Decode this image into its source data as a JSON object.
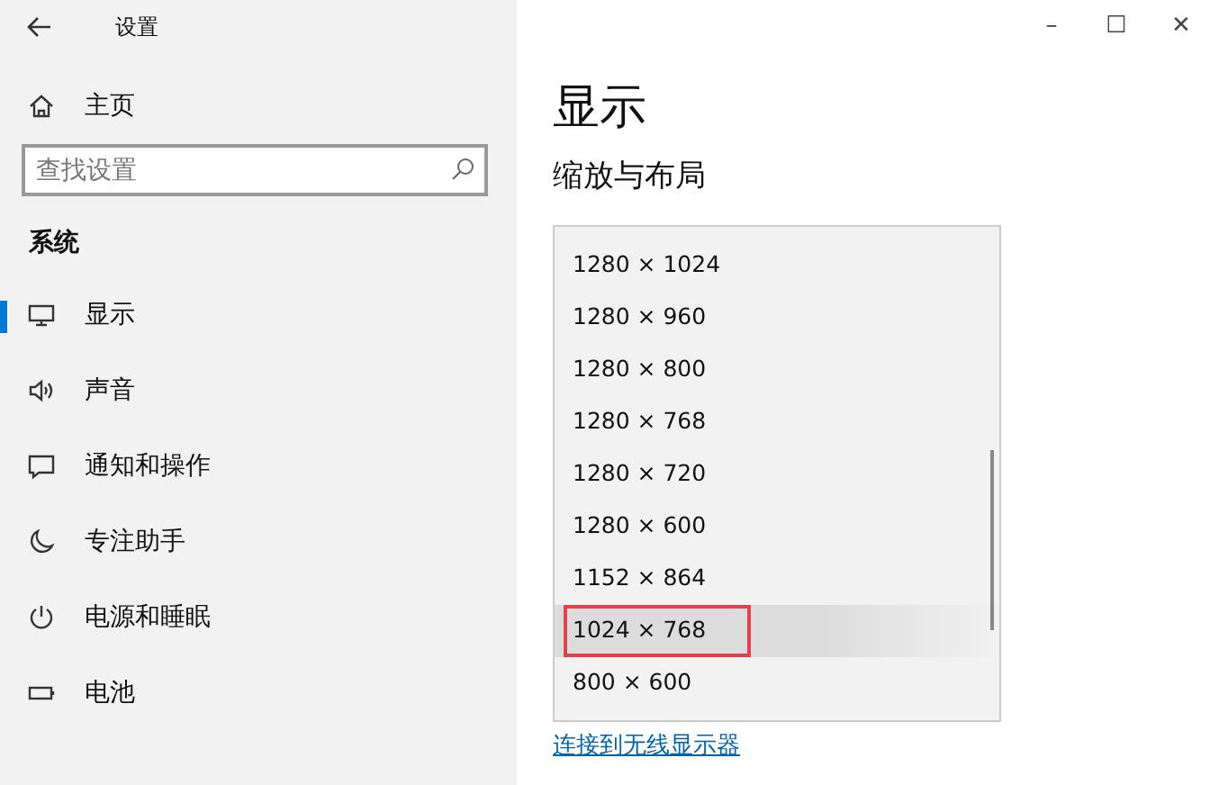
{
  "window": {
    "title": "设置",
    "controls": [
      "–",
      "☐",
      "✕"
    ]
  },
  "sidebar": {
    "home": "主页",
    "search": {
      "placeholder": "查找设置"
    },
    "section": "系统",
    "items": [
      {
        "label": "显示",
        "selected": true
      },
      {
        "label": "声音",
        "selected": false
      },
      {
        "label": "通知和操作",
        "selected": false
      },
      {
        "label": "专注助手",
        "selected": false
      },
      {
        "label": "电源和睡眠",
        "selected": false
      },
      {
        "label": "电池",
        "selected": false
      }
    ]
  },
  "main": {
    "title": "显示",
    "section": "缩放与布局",
    "resolutions": [
      {
        "label": "1280 × 1024",
        "selected": false,
        "annotated": false
      },
      {
        "label": "1280 × 960",
        "selected": false,
        "annotated": false
      },
      {
        "label": "1280 × 800",
        "selected": false,
        "annotated": false
      },
      {
        "label": "1280 × 768",
        "selected": false,
        "annotated": false
      },
      {
        "label": "1280 × 720",
        "selected": false,
        "annotated": false
      },
      {
        "label": "1280 × 600",
        "selected": false,
        "annotated": false
      },
      {
        "label": "1152 × 864",
        "selected": false,
        "annotated": false
      },
      {
        "label": "1024 × 768",
        "selected": true,
        "annotated": true
      },
      {
        "label": "800 × 600",
        "selected": false,
        "annotated": false
      }
    ],
    "link": "连接到无线显示器"
  }
}
